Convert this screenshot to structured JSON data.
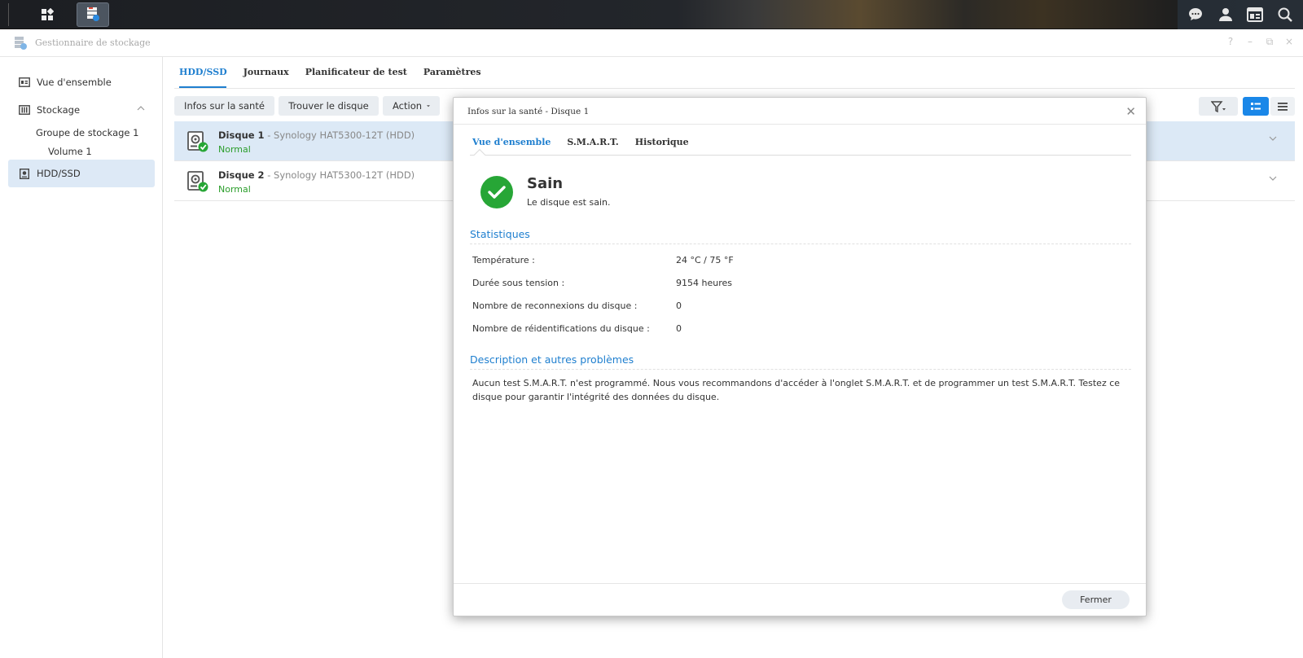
{
  "taskbar": {
    "left_icons": [
      "main-menu-icon",
      "storage-manager-app-icon"
    ],
    "right_icons": [
      "chat-icon",
      "user-icon",
      "widgets-icon",
      "search-icon"
    ]
  },
  "window": {
    "title": "Gestionnaire de stockage",
    "controls": [
      "?",
      "–",
      "⧉",
      "×"
    ]
  },
  "sidebar": {
    "overview": "Vue d'ensemble",
    "storage": "Stockage",
    "storage_pool": "Groupe de stockage 1",
    "volume": "Volume 1",
    "hdd_ssd": "HDD/SSD"
  },
  "tabs": [
    "HDD/SSD",
    "Journaux",
    "Planificateur de test",
    "Paramètres"
  ],
  "toolbar": {
    "health_info": "Infos sur la santé",
    "locate_disk": "Trouver le disque",
    "action": "Action"
  },
  "disks": [
    {
      "name": "Disque 1",
      "sep": " - ",
      "model": "Synology HAT5300-12T (HDD)",
      "status": "Normal",
      "selected": true
    },
    {
      "name": "Disque 2",
      "sep": " - ",
      "model": "Synology HAT5300-12T (HDD)",
      "status": "Normal",
      "selected": false
    }
  ],
  "dialog": {
    "title": "Infos sur la santé - Disque 1",
    "tabs": [
      "Vue d'ensemble",
      "S.M.A.R.T.",
      "Historique"
    ],
    "status_title": "Sain",
    "status_desc": "Le disque est sain.",
    "stats_title": "Statistiques",
    "stats": [
      {
        "label": "Température :",
        "value": "24 °C / 75 °F"
      },
      {
        "label": "Durée sous tension :",
        "value": "9154 heures"
      },
      {
        "label": "Nombre de reconnexions du disque :",
        "value": "0"
      },
      {
        "label": "Nombre de réidentifications du disque :",
        "value": "0"
      }
    ],
    "desc_title": "Description et autres problèmes",
    "desc_text": "Aucun test S.M.A.R.T. n'est programmé. Nous vous recommandons d'accéder à l'onglet S.M.A.R.T. et de programmer un test S.M.A.R.T. Testez ce disque pour garantir l'intégrité des données du disque.",
    "close_label": "Fermer"
  },
  "colors": {
    "accent": "#1f7fcf",
    "status_ok": "#2a9d2a",
    "selected_row": "#dce9f6",
    "healthy_badge": "#27a636"
  }
}
